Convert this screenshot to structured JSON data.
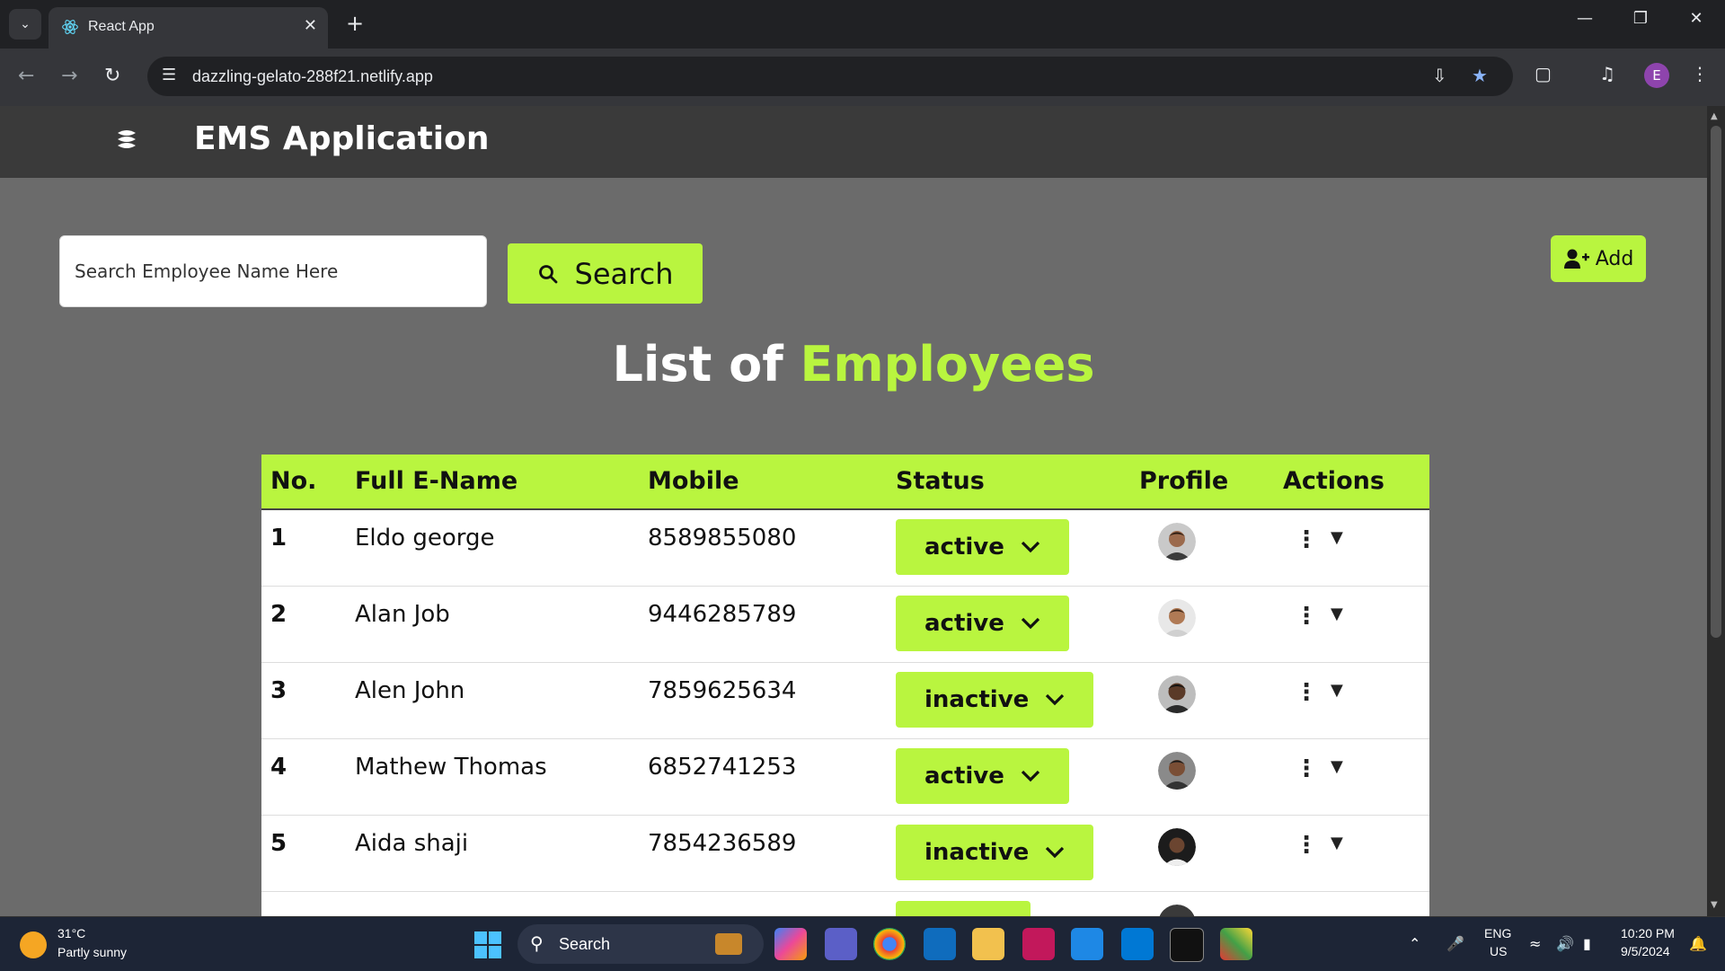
{
  "browser": {
    "tab_title": "React App",
    "url": "dazzling-gelato-288f21.netlify.app",
    "profile_initial": "E"
  },
  "app": {
    "title": "EMS Application",
    "search_placeholder": "Search Employee Name Here",
    "search_button": "Search",
    "add_button": "Add",
    "heading_prefix": "List of",
    "heading_accent": "Employees",
    "accent_color": "#b9f53f"
  },
  "table": {
    "headers": [
      "No.",
      "Full E-Name",
      "Mobile",
      "Status",
      "Profile",
      "Actions"
    ],
    "rows": [
      {
        "no": "1",
        "name": "Eldo george",
        "mobile": "8589855080",
        "status": "active"
      },
      {
        "no": "2",
        "name": "Alan Job",
        "mobile": "9446285789",
        "status": "active"
      },
      {
        "no": "3",
        "name": "Alen John",
        "mobile": "7859625634",
        "status": "inactive"
      },
      {
        "no": "4",
        "name": "Mathew Thomas",
        "mobile": "6852741253",
        "status": "active"
      },
      {
        "no": "5",
        "name": "Aida shaji",
        "mobile": "7854236589",
        "status": "inactive"
      }
    ]
  },
  "taskbar": {
    "temperature": "31°C",
    "weather": "Partly sunny",
    "search_label": "Search",
    "lang_line1": "ENG",
    "lang_line2": "US",
    "time": "10:20 PM",
    "date": "9/5/2024"
  }
}
